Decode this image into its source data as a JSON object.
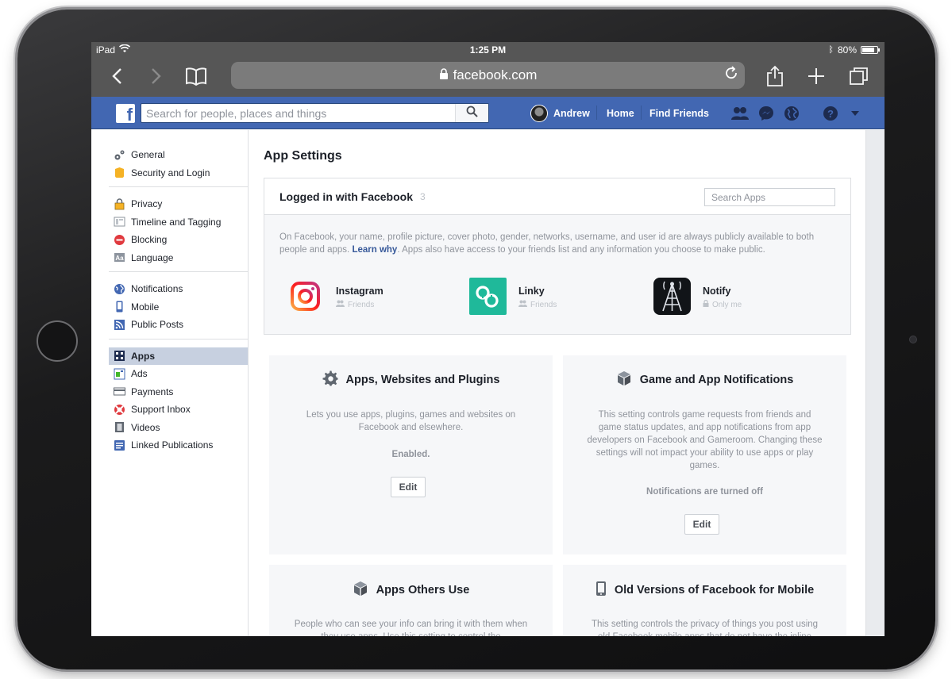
{
  "status_bar": {
    "device": "iPad",
    "time": "1:25 PM",
    "battery": "80%"
  },
  "safari": {
    "url": "facebook.com"
  },
  "facebook_header": {
    "search_placeholder": "Search for people, places and things",
    "user_name": "Andrew",
    "nav_home": "Home",
    "nav_find_friends": "Find Friends",
    "brand_color": "#4267b2"
  },
  "sidebar": {
    "groups": [
      [
        {
          "label": "General",
          "icon": "gear-icon"
        },
        {
          "label": "Security and Login",
          "icon": "badge-icon"
        }
      ],
      [
        {
          "label": "Privacy",
          "icon": "lock-icon"
        },
        {
          "label": "Timeline and Tagging",
          "icon": "timeline-icon"
        },
        {
          "label": "Blocking",
          "icon": "block-icon"
        },
        {
          "label": "Language",
          "icon": "language-icon"
        }
      ],
      [
        {
          "label": "Notifications",
          "icon": "globe-icon"
        },
        {
          "label": "Mobile",
          "icon": "mobile-icon"
        },
        {
          "label": "Public Posts",
          "icon": "rss-icon"
        }
      ],
      [
        {
          "label": "Apps",
          "icon": "apps-icon",
          "active": true
        },
        {
          "label": "Ads",
          "icon": "ads-icon"
        },
        {
          "label": "Payments",
          "icon": "card-icon"
        },
        {
          "label": "Support Inbox",
          "icon": "lifebuoy-icon"
        },
        {
          "label": "Videos",
          "icon": "film-icon"
        },
        {
          "label": "Linked Publications",
          "icon": "publication-icon"
        }
      ]
    ]
  },
  "main": {
    "title": "App Settings",
    "logged_in": {
      "title": "Logged in with Facebook",
      "count": "3",
      "search_placeholder": "Search Apps",
      "desc_part1": "On Facebook, your name, profile picture, cover photo, gender, networks, username, and user id are always publicly available to both people and apps. ",
      "learn_why": "Learn why",
      "desc_part2": ". Apps also have access to your friends list and any information you choose to make public.",
      "apps": [
        {
          "name": "Instagram",
          "privacy": "Friends"
        },
        {
          "name": "Linky",
          "privacy": "Friends"
        },
        {
          "name": "Notify",
          "privacy": "Only me"
        }
      ]
    },
    "cards": {
      "plugins": {
        "title": "Apps, Websites and Plugins",
        "desc": "Lets you use apps, plugins, games and websites on Facebook and elsewhere.",
        "status": "Enabled.",
        "button": "Edit"
      },
      "game_notifications": {
        "title": "Game and App Notifications",
        "desc": "This setting controls game requests from friends and game status updates, and app notifications from app developers on Facebook and Gameroom. Changing these settings will not impact your ability to use apps or play games.",
        "status": "Notifications are turned off",
        "button": "Edit"
      },
      "others_use": {
        "title": "Apps Others Use",
        "desc": "People who can see your info can bring it with them when they use apps. Use this setting to control the"
      },
      "old_versions": {
        "title": "Old Versions of Facebook for Mobile",
        "desc": "This setting controls the privacy of things you post using old Facebook mobile apps that do not have the inline"
      }
    }
  }
}
